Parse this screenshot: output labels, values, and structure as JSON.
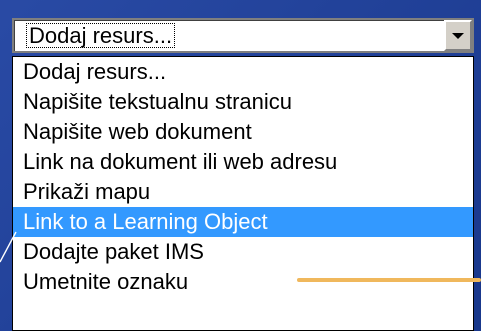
{
  "colors": {
    "background": "#1c3f9f",
    "selection_bg": "#3399ff",
    "accent_line": "#f0b85c"
  },
  "select": {
    "value": "Dodaj resurs...",
    "button_icon": "chevron-down-icon"
  },
  "list": {
    "items": [
      {
        "label": "Dodaj resurs...",
        "selected": false
      },
      {
        "label": "Napišite tekstualnu stranicu",
        "selected": false
      },
      {
        "label": "Napišite web dokument",
        "selected": false
      },
      {
        "label": "Link na dokument ili web adresu",
        "selected": false
      },
      {
        "label": "Prikaži mapu",
        "selected": false
      },
      {
        "label": "Link to a Learning Object",
        "selected": true
      },
      {
        "label": "Dodajte paket IMS",
        "selected": false
      },
      {
        "label": "Umetnite oznaku",
        "selected": false
      }
    ]
  }
}
